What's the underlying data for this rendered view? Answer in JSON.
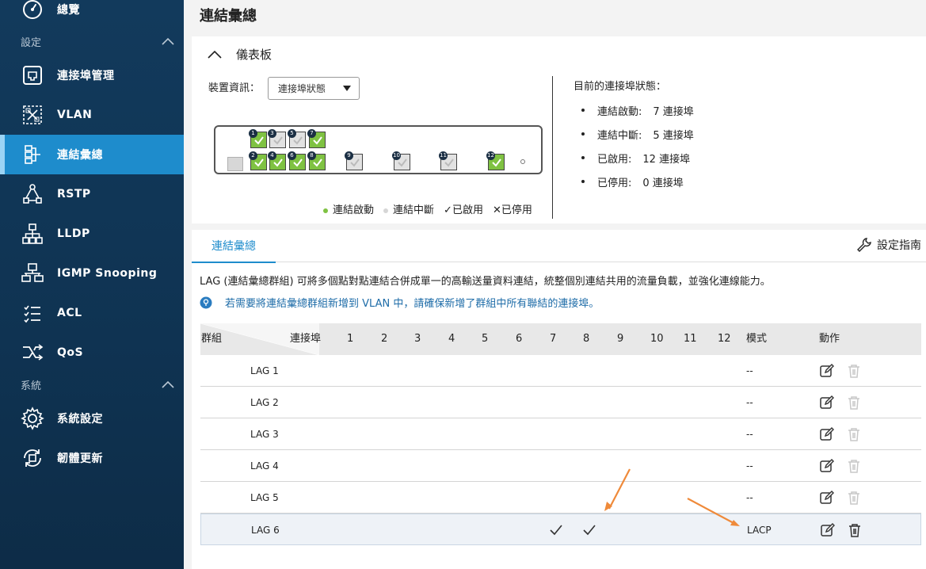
{
  "sidebar": {
    "overview": {
      "label": "總覽",
      "icon": "dashboard-gauge-icon"
    },
    "settings_section": "設定",
    "items": [
      {
        "label": "連接埠管理",
        "icon": "ethernet-port-icon"
      },
      {
        "label": "VLAN",
        "icon": "vlan-icon"
      },
      {
        "label": "連結彙總",
        "icon": "link-aggregation-icon",
        "active": true
      },
      {
        "label": "RSTP",
        "icon": "rstp-tree-icon"
      },
      {
        "label": "LLDP",
        "icon": "lldp-topology-icon"
      },
      {
        "label": "IGMP Snooping",
        "icon": "igmp-snooping-icon"
      },
      {
        "label": "ACL",
        "icon": "acl-list-icon"
      },
      {
        "label": "QoS",
        "icon": "qos-icon"
      }
    ],
    "system_section": "系統",
    "system_items": [
      {
        "label": "系統設定",
        "icon": "gear-icon"
      },
      {
        "label": "韌體更新",
        "icon": "firmware-update-icon"
      }
    ]
  },
  "page": {
    "title": "連結彙總"
  },
  "dashboard": {
    "title": "儀表板",
    "device_info_label": "裝置資訊：",
    "device_select_value": "連接埠狀態",
    "port_numbers": [
      "1",
      "2",
      "3",
      "4",
      "5",
      "6",
      "7",
      "8",
      "9",
      "10",
      "11",
      "12"
    ],
    "legend": {
      "link_up": "連結啟動",
      "link_down": "連結中斷",
      "enabled": "已啟用",
      "disabled": "已停用"
    },
    "status_title": "目前的連接埠狀態：",
    "status": [
      {
        "label": "連結啟動:",
        "value": "7 連接埠"
      },
      {
        "label": "連結中斷:",
        "value": "5 連接埠"
      },
      {
        "label": "已啟用:",
        "value": "12 連接埠"
      },
      {
        "label": "已停用:",
        "value": "0 連接埠"
      }
    ]
  },
  "lag": {
    "tab_label": "連結彙總",
    "guide_label": "設定指南",
    "description": "LAG (連結彙總群組) 可將多個點對點連結合併成單一的高輸送量資料連結，統整個別連結共用的流量負載，並強化連線能力。",
    "note": "若需要將連結彙總群組新增到 VLAN 中，請確保新增了群組中所有聯結的連接埠。",
    "headers": {
      "group": "群組",
      "port": "連接埠",
      "ports": [
        "1",
        "2",
        "3",
        "4",
        "5",
        "6",
        "7",
        "8",
        "9",
        "10",
        "11",
        "12"
      ],
      "mode": "模式",
      "action": "動作"
    },
    "rows": [
      {
        "name": "LAG 1",
        "mode": "--"
      },
      {
        "name": "LAG 2",
        "mode": "--"
      },
      {
        "name": "LAG 3",
        "mode": "--"
      },
      {
        "name": "LAG 4",
        "mode": "--"
      },
      {
        "name": "LAG 5",
        "mode": "--"
      },
      {
        "name": "LAG 6",
        "mode": "LACP"
      }
    ]
  },
  "colors": {
    "sidebar_bg": "#123a5c",
    "active": "#1e8ccc",
    "link_up": "#7fc242",
    "arrow": "#ef8a3a"
  }
}
